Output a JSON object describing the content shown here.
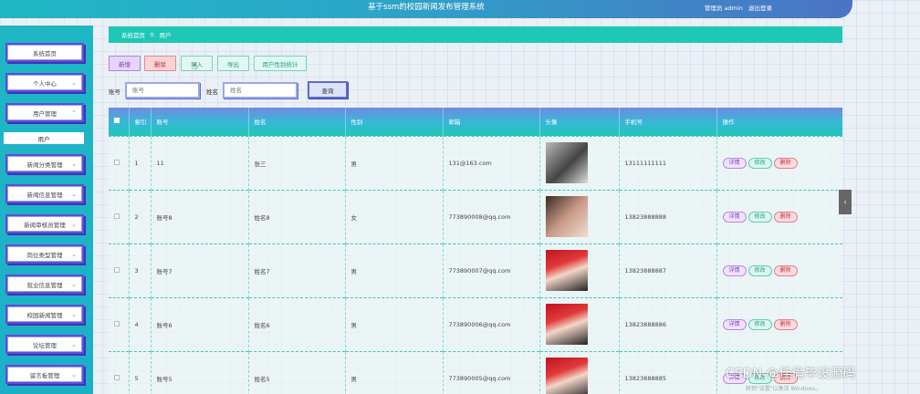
{
  "header": {
    "title": "基于ssm的校园新闻发布管理系统",
    "user_label": "管理员 admin",
    "logout": "退出登录"
  },
  "sidebar": {
    "items": [
      {
        "label": "系统首页",
        "chevron": false
      },
      {
        "label": "个人中心",
        "chevron": true
      },
      {
        "label": "用户管理",
        "chevron": true,
        "expanded": true
      },
      {
        "label": "新闻分类管理",
        "chevron": true
      },
      {
        "label": "新闻信息管理",
        "chevron": true
      },
      {
        "label": "新闻审核员管理",
        "chevron": true
      },
      {
        "label": "岗位类型管理",
        "chevron": true
      },
      {
        "label": "就业信息管理",
        "chevron": true
      },
      {
        "label": "校园新闻管理",
        "chevron": true
      },
      {
        "label": "论坛管理",
        "chevron": true
      },
      {
        "label": "留言板管理",
        "chevron": true
      }
    ],
    "submenu_active": "用户"
  },
  "breadcrumb": {
    "home": "系统首页",
    "sep": "≡",
    "current": "用户"
  },
  "toolbar": {
    "add": "新增",
    "delete": "删除",
    "import": "导入",
    "export": "导出",
    "stats": "用户性别统计"
  },
  "search": {
    "account_label": "账号",
    "account_placeholder": "账号",
    "name_label": "姓名",
    "name_placeholder": "姓名",
    "query": "查询"
  },
  "table": {
    "headers": [
      "索引",
      "账号",
      "姓名",
      "性别",
      "邮箱",
      "头像",
      "手机号",
      "操作"
    ],
    "rows": [
      {
        "idx": "1",
        "account": "11",
        "name": "张三",
        "gender": "男",
        "email": "131@163.com",
        "phone": "13111111111"
      },
      {
        "idx": "2",
        "account": "账号8",
        "name": "姓名8",
        "gender": "女",
        "email": "773890008@qq.com",
        "phone": "13823888888"
      },
      {
        "idx": "3",
        "account": "账号7",
        "name": "姓名7",
        "gender": "男",
        "email": "773890007@qq.com",
        "phone": "13823888887"
      },
      {
        "idx": "4",
        "account": "账号6",
        "name": "姓名6",
        "gender": "男",
        "email": "773890006@qq.com",
        "phone": "13823888886"
      },
      {
        "idx": "5",
        "account": "账号5",
        "name": "姓名5",
        "gender": "男",
        "email": "773890005@qq.com",
        "phone": "13823888885"
      }
    ],
    "ops": {
      "detail": "详情",
      "edit": "修改",
      "delete": "删除"
    }
  },
  "watermark": "CSDN @佳倫毕设源码",
  "win_hint": "转到\"设置\"以激活 Windows。",
  "colors": {
    "header": "#2aa8c8",
    "sidebar": "#1fb7c4",
    "breadcrumb": "#1ec7b6",
    "menu_border": "#5a4fd8"
  }
}
